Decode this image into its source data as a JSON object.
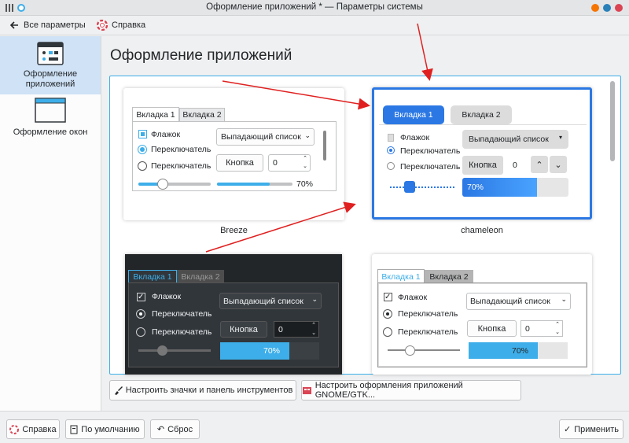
{
  "window": {
    "title": "Оформление приложений * — Параметры системы"
  },
  "toolbar": {
    "back_label": "Все параметры",
    "help_label": "Справка"
  },
  "sidebar": {
    "items": [
      {
        "label": "Оформление приложений"
      },
      {
        "label": "Оформление окон"
      }
    ]
  },
  "page": {
    "title": "Оформление приложений"
  },
  "previews": [
    {
      "name": "Breeze",
      "tab1": "Вкладка 1",
      "tab2": "Вкладка 2",
      "checkbox": "Флажок",
      "radio1": "Переключатель",
      "radio2": "Переключатель",
      "combo": "Выпадающий список",
      "button": "Кнопка",
      "spin": "0",
      "progress_text": "70%"
    },
    {
      "name": "chameleon",
      "tab1": "Вкладка 1",
      "tab2": "Вкладка 2",
      "checkbox": "Флажок",
      "radio1": "Переключатель",
      "radio2": "Переключатель",
      "combo": "Выпадающий список",
      "button": "Кнопка",
      "spin": "0",
      "progress_text": "70%"
    },
    {
      "name": "",
      "tab1": "Вкладка 1",
      "tab2": "Вкладка 2",
      "checkbox": "Флажок",
      "radio1": "Переключатель",
      "radio2": "Переключатель",
      "combo": "Выпадающий список",
      "button": "Кнопка",
      "spin": "0",
      "progress_text": "70%"
    },
    {
      "name": "",
      "tab1": "Вкладка 1",
      "tab2": "Вкладка 2",
      "checkbox": "Флажок",
      "radio1": "Переключатель",
      "radio2": "Переключатель",
      "combo": "Выпадающий список",
      "button": "Кнопка",
      "spin": "0",
      "progress_text": "70%"
    }
  ],
  "progress_value": 0.7,
  "actions": {
    "icons_button": "Настроить значки и панель инструментов",
    "gtk_button": "Настроить оформления приложений GNOME/GTK..."
  },
  "footer": {
    "help": "Справка",
    "defaults": "По умолчанию",
    "reset": "Сброс",
    "apply": "Применить"
  },
  "colors": {
    "accent": "#3daee9",
    "selection": "#cfe2f6",
    "chameleon_blue": "#2b78e4",
    "dark_bg": "#232629",
    "annotation_arrow": "#e02020"
  }
}
